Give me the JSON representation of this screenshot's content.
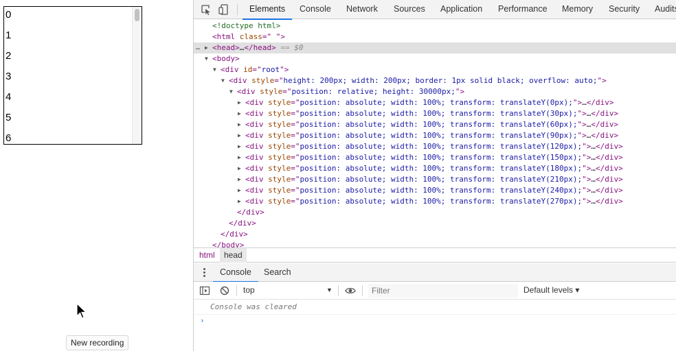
{
  "viewport": {
    "rows": [
      "0",
      "1",
      "2",
      "3",
      "4",
      "5",
      "6"
    ],
    "tooltip": "New recording"
  },
  "devtools": {
    "toolbar": {
      "inspect_icon": "inspect-element-icon",
      "device_icon": "device-toolbar-icon"
    },
    "tabs": [
      "Elements",
      "Console",
      "Network",
      "Sources",
      "Application",
      "Performance",
      "Memory",
      "Security",
      "Audits"
    ],
    "active_tab": "Elements",
    "dom_lines": [
      {
        "indent": 0,
        "arrow": "",
        "html": "<span class=\"cm\">&lt;!doctype html&gt;</span>"
      },
      {
        "indent": 0,
        "arrow": "",
        "html": "<span class=\"tag\">&lt;html</span> <span class=\"an\">class</span><span class=\"tag\">=\"</span><span class=\"av\"> </span><span class=\"tag\">\"&gt;</span>"
      },
      {
        "indent": 0,
        "arrow": "▶",
        "sel": true,
        "html": "<span class=\"tag\">&lt;head&gt;</span>…<span class=\"tag\">&lt;/head&gt;</span> <span class=\"muted\">== </span><span class=\"dt\" style=\"font-style:italic\">$0</span>"
      },
      {
        "indent": 0,
        "arrow": "▼",
        "html": "<span class=\"tag\">&lt;body&gt;</span>"
      },
      {
        "indent": 1,
        "arrow": "▼",
        "html": "<span class=\"tag\">&lt;div</span> <span class=\"an\">id</span><span class=\"tag\">=\"</span><span class=\"av\">root</span><span class=\"tag\">\"&gt;</span>"
      },
      {
        "indent": 2,
        "arrow": "▼",
        "html": "<span class=\"tag\">&lt;div</span> <span class=\"an\">style</span><span class=\"tag\">=\"</span><span class=\"av\">height: 200px; width: 200px; border: 1px solid black; overflow: auto;</span><span class=\"tag\">\"&gt;</span>"
      },
      {
        "indent": 3,
        "arrow": "▼",
        "html": "<span class=\"tag\">&lt;div</span> <span class=\"an\">style</span><span class=\"tag\">=\"</span><span class=\"av\">position: relative; height: 30000px;</span><span class=\"tag\">\"&gt;</span>"
      },
      {
        "indent": 4,
        "arrow": "▶",
        "html": "<span class=\"tag\">&lt;div</span> <span class=\"an\">style</span><span class=\"tag\">=\"</span><span class=\"av\">position: absolute; width: 100%; transform: translateY(0px);</span><span class=\"tag\">\"&gt;</span>…<span class=\"tag\">&lt;/div&gt;</span>"
      },
      {
        "indent": 4,
        "arrow": "▶",
        "html": "<span class=\"tag\">&lt;div</span> <span class=\"an\">style</span><span class=\"tag\">=\"</span><span class=\"av\">position: absolute; width: 100%; transform: translateY(30px);</span><span class=\"tag\">\"&gt;</span>…<span class=\"tag\">&lt;/div&gt;</span>"
      },
      {
        "indent": 4,
        "arrow": "▶",
        "html": "<span class=\"tag\">&lt;div</span> <span class=\"an\">style</span><span class=\"tag\">=\"</span><span class=\"av\">position: absolute; width: 100%; transform: translateY(60px);</span><span class=\"tag\">\"&gt;</span>…<span class=\"tag\">&lt;/div&gt;</span>"
      },
      {
        "indent": 4,
        "arrow": "▶",
        "html": "<span class=\"tag\">&lt;div</span> <span class=\"an\">style</span><span class=\"tag\">=\"</span><span class=\"av\">position: absolute; width: 100%; transform: translateY(90px);</span><span class=\"tag\">\"&gt;</span>…<span class=\"tag\">&lt;/div&gt;</span>"
      },
      {
        "indent": 4,
        "arrow": "▶",
        "html": "<span class=\"tag\">&lt;div</span> <span class=\"an\">style</span><span class=\"tag\">=\"</span><span class=\"av\">position: absolute; width: 100%; transform: translateY(120px);</span><span class=\"tag\">\"&gt;</span>…<span class=\"tag\">&lt;/div&gt;</span>"
      },
      {
        "indent": 4,
        "arrow": "▶",
        "html": "<span class=\"tag\">&lt;div</span> <span class=\"an\">style</span><span class=\"tag\">=\"</span><span class=\"av\">position: absolute; width: 100%; transform: translateY(150px);</span><span class=\"tag\">\"&gt;</span>…<span class=\"tag\">&lt;/div&gt;</span>"
      },
      {
        "indent": 4,
        "arrow": "▶",
        "html": "<span class=\"tag\">&lt;div</span> <span class=\"an\">style</span><span class=\"tag\">=\"</span><span class=\"av\">position: absolute; width: 100%; transform: translateY(180px);</span><span class=\"tag\">\"&gt;</span>…<span class=\"tag\">&lt;/div&gt;</span>"
      },
      {
        "indent": 4,
        "arrow": "▶",
        "html": "<span class=\"tag\">&lt;div</span> <span class=\"an\">style</span><span class=\"tag\">=\"</span><span class=\"av\">position: absolute; width: 100%; transform: translateY(210px);</span><span class=\"tag\">\"&gt;</span>…<span class=\"tag\">&lt;/div&gt;</span>"
      },
      {
        "indent": 4,
        "arrow": "▶",
        "html": "<span class=\"tag\">&lt;div</span> <span class=\"an\">style</span><span class=\"tag\">=\"</span><span class=\"av\">position: absolute; width: 100%; transform: translateY(240px);</span><span class=\"tag\">\"&gt;</span>…<span class=\"tag\">&lt;/div&gt;</span>"
      },
      {
        "indent": 4,
        "arrow": "▶",
        "html": "<span class=\"tag\">&lt;div</span> <span class=\"an\">style</span><span class=\"tag\">=\"</span><span class=\"av\">position: absolute; width: 100%; transform: translateY(270px);</span><span class=\"tag\">\"&gt;</span>…<span class=\"tag\">&lt;/div&gt;</span>"
      },
      {
        "indent": 3,
        "arrow": "",
        "html": "<span class=\"tag\">&lt;/div&gt;</span>"
      },
      {
        "indent": 2,
        "arrow": "",
        "html": "<span class=\"tag\">&lt;/div&gt;</span>"
      },
      {
        "indent": 1,
        "arrow": "",
        "html": "<span class=\"tag\">&lt;/div&gt;</span>"
      },
      {
        "indent": 0,
        "arrow": "",
        "html": "<span class=\"tag\">&lt;/body&gt;</span>"
      }
    ],
    "breadcrumbs": [
      "html",
      "head"
    ],
    "drawer": {
      "tabs": [
        "Console",
        "Search"
      ],
      "active_tab": "Console",
      "context": "top",
      "filter_placeholder": "Filter",
      "levels": "Default levels ▾",
      "message": "Console was cleared",
      "prompt": "›"
    }
  }
}
